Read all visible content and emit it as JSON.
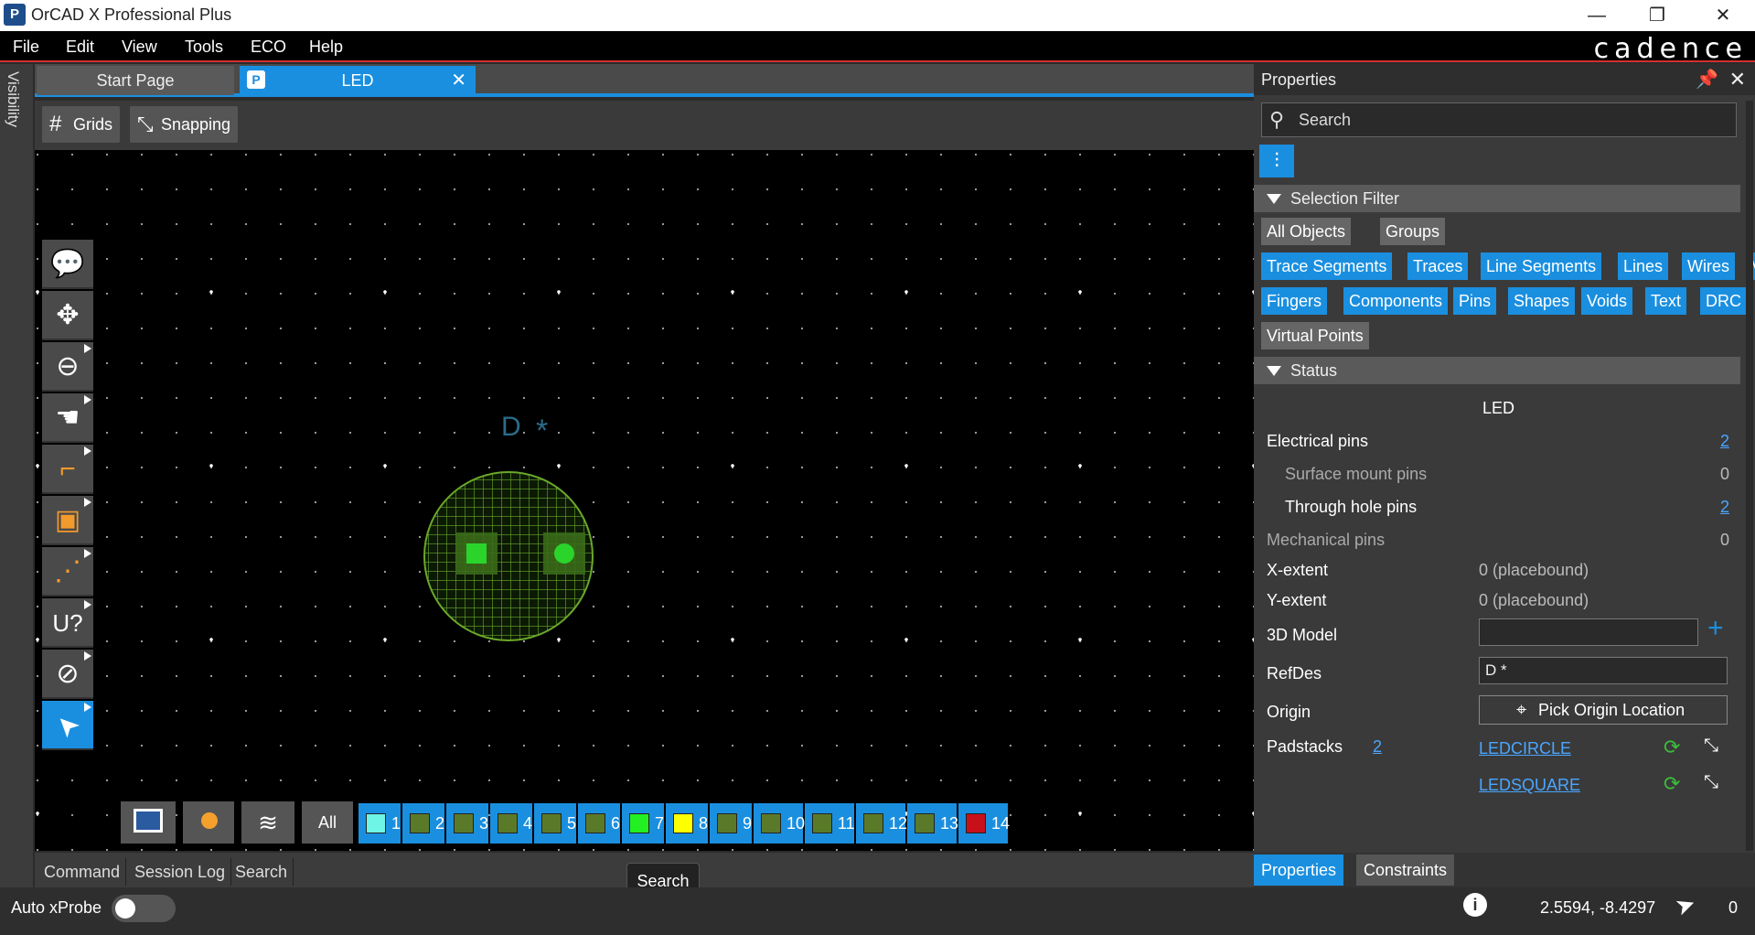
{
  "window": {
    "title": "OrCAD X Professional Plus",
    "brand": "cadence"
  },
  "menu": {
    "items": [
      "File",
      "Edit",
      "View",
      "Tools",
      "ECO",
      "Help"
    ]
  },
  "sidebar": {
    "label": "Visibility"
  },
  "tabs": {
    "start": "Start Page",
    "active": "LED"
  },
  "toolbar": {
    "grids": "Grids",
    "snapping": "Snapping"
  },
  "canvas": {
    "refdes_text": "D",
    "origin_marker": "*",
    "colors": {
      "pad_green": "#2bd42b",
      "outline": "#6aa82a"
    }
  },
  "side_tools": [
    {
      "name": "comment-tool",
      "icon": "comment-icon",
      "glyph": "💬"
    },
    {
      "name": "move-tool",
      "icon": "move-icon",
      "glyph": "✥"
    },
    {
      "name": "zoom-area-tool",
      "icon": "zoom-area-icon",
      "glyph": "⊖"
    },
    {
      "name": "pan-tool",
      "icon": "hand-icon",
      "glyph": "☚"
    },
    {
      "name": "route-tool",
      "icon": "route-icon",
      "glyph": "⌐"
    },
    {
      "name": "add-component-tool",
      "icon": "add-component-icon",
      "glyph": "▣"
    },
    {
      "name": "fanout-tool",
      "icon": "fanout-icon",
      "glyph": "⋰"
    },
    {
      "name": "refdes-tool",
      "icon": "refdes-icon",
      "glyph": "U?"
    },
    {
      "name": "zoom-tool",
      "icon": "zoom-icon",
      "glyph": "⊘"
    },
    {
      "name": "select-tool",
      "icon": "select-arrow-icon",
      "glyph": "➤"
    }
  ],
  "layers": {
    "all_label": "All",
    "items": [
      {
        "n": "1",
        "color": "#6ff5e6"
      },
      {
        "n": "2",
        "color": "#5a7a2a"
      },
      {
        "n": "3",
        "color": "#5a7a2a"
      },
      {
        "n": "4",
        "color": "#5a7a2a"
      },
      {
        "n": "5",
        "color": "#5a7a2a"
      },
      {
        "n": "6",
        "color": "#5a7a2a"
      },
      {
        "n": "7",
        "color": "#22f022"
      },
      {
        "n": "8",
        "color": "#ffff00"
      },
      {
        "n": "9",
        "color": "#5a7a2a"
      },
      {
        "n": "10",
        "color": "#5a7a2a"
      },
      {
        "n": "11",
        "color": "#5a7a2a"
      },
      {
        "n": "12",
        "color": "#5a7a2a"
      },
      {
        "n": "13",
        "color": "#5a7a2a"
      },
      {
        "n": "14",
        "color": "#c8101a"
      }
    ]
  },
  "bottom_tabs": [
    "Command",
    "Session Log",
    "Search"
  ],
  "tooltip": "Search",
  "status": {
    "xprobe_label": "Auto xProbe",
    "coords": "2.5594, -8.4297",
    "count": "0"
  },
  "properties": {
    "title": "Properties",
    "search_placeholder": "Search",
    "selection_filter": "Selection Filter",
    "chips_row1": [
      "All Objects",
      "Groups"
    ],
    "chips_row2": [
      "Trace Segments",
      "Traces",
      "Line Segments",
      "Lines",
      "Wires",
      "Vias"
    ],
    "chips_row3": [
      "Fingers",
      "Components",
      "Pins",
      "Shapes",
      "Voids",
      "Text",
      "DRC"
    ],
    "chips_row4": [
      "Virtual Points"
    ],
    "status_section": "Status",
    "component_name": "LED",
    "electrical_pins_label": "Electrical pins",
    "electrical_pins_value": "2",
    "smd_label": "Surface mount pins",
    "smd_value": "0",
    "th_label": "Through hole pins",
    "th_value": "2",
    "mech_label": "Mechanical pins",
    "mech_value": "0",
    "xext_label": "X-extent",
    "xext_value": "0 (placebound)",
    "yext_label": "Y-extent",
    "yext_value": "0 (placebound)",
    "model_label": "3D Model",
    "model_value": "",
    "refdes_label": "RefDes",
    "refdes_value": "D *",
    "origin_label": "Origin",
    "origin_button": "Pick Origin Location",
    "padstacks_label": "Padstacks",
    "padstacks_count": "2",
    "padstack1": "LEDCIRCLE",
    "padstack2": "LEDSQUARE",
    "bottom_tab_properties": "Properties",
    "bottom_tab_constraints": "Constraints"
  }
}
